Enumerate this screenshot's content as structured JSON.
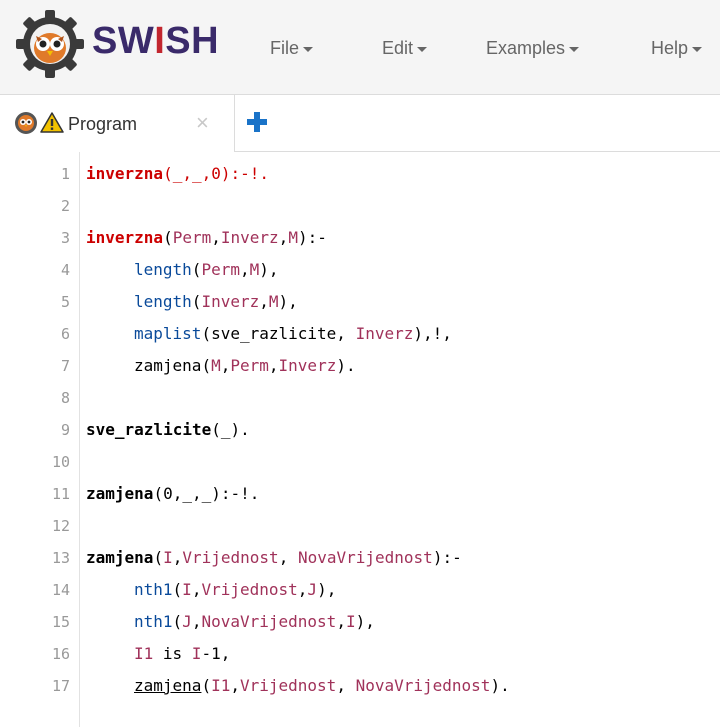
{
  "app": {
    "brand_prefix": "SW",
    "brand_i": "I",
    "brand_suffix": "SH"
  },
  "menu": [
    {
      "label": "File"
    },
    {
      "label": "Edit"
    },
    {
      "label": "Examples"
    },
    {
      "label": "Help"
    }
  ],
  "tab": {
    "label": "Program",
    "close": "×"
  },
  "lines": [
    "1",
    "2",
    "3",
    "4",
    "5",
    "6",
    "7",
    "8",
    "9",
    "10",
    "11",
    "12",
    "13",
    "14",
    "15",
    "16",
    "17"
  ],
  "code": {
    "l1": {
      "head": "inverzna",
      "rest": "(_,_,0):-!."
    },
    "l3": {
      "head": "inverzna",
      "a": "(",
      "v1": "Perm",
      "c1": ",",
      "v2": "Inverz",
      "c2": ",",
      "v3": "M",
      "end": "):-"
    },
    "l4": {
      "b": "length",
      "a": "(",
      "v1": "Perm",
      "c": ",",
      "v2": "M",
      "end": "),"
    },
    "l5": {
      "b": "length",
      "a": "(",
      "v1": "Inverz",
      "c": ",",
      "v2": "M",
      "end": "),"
    },
    "l6": {
      "b": "maplist",
      "a": "(sve_razlicite, ",
      "v1": "Inverz",
      "end": "),!,"
    },
    "l7": {
      "p": "zamjena",
      "a": "(",
      "v1": "M",
      "c1": ",",
      "v2": "Perm",
      "c2": ",",
      "v3": "Inverz",
      "end": ")."
    },
    "l9": {
      "head": "sve_razlicite",
      "rest": "(_)."
    },
    "l11": {
      "head": "zamjena",
      "rest": "(0,_,_):-!."
    },
    "l13": {
      "head": "zamjena",
      "a": "(",
      "v1": "I",
      "c1": ",",
      "v2": "Vrijednost",
      "c2": ", ",
      "v3": "NovaVrijednost",
      "end": "):-"
    },
    "l14": {
      "b": "nth1",
      "a": "(",
      "v1": "I",
      "c1": ",",
      "v2": "Vrijednost",
      "c2": ",",
      "v3": "J",
      "end": "),"
    },
    "l15": {
      "b": "nth1",
      "a": "(",
      "v1": "J",
      "c1": ",",
      "v2": "NovaVrijednost",
      "c2": ",",
      "v3": "I",
      "end": "),"
    },
    "l16": {
      "v1": "I1",
      "op": " is ",
      "v2": "I",
      "end": "-1,"
    },
    "l17": {
      "p": "zamjena",
      "a": "(",
      "v1": "I1",
      "c1": ",",
      "v2": "Vrijednost",
      "c2": ", ",
      "v3": "NovaVrijednost",
      "end": ")."
    }
  },
  "colors": {
    "brand": "#3a2a6a",
    "accent_red": "#cc0000",
    "builtin": "#0a4a9a",
    "variable": "#a0325a",
    "add_button": "#1a73c8"
  },
  "icons": [
    "swish-logo-icon",
    "owl-icon",
    "warning-icon",
    "close-icon",
    "plus-icon",
    "caret-down-icon"
  ]
}
